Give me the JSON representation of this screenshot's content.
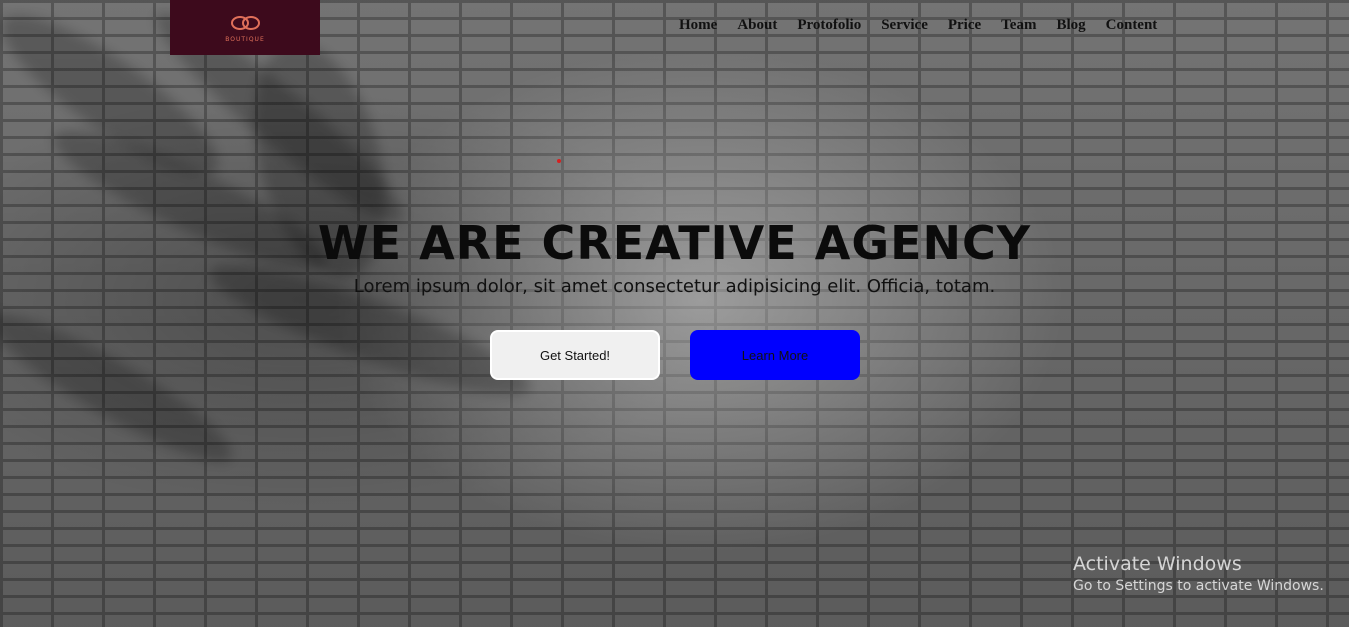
{
  "header": {
    "logo_text": "BOUTIQUE",
    "nav": [
      {
        "label": "Home"
      },
      {
        "label": "About"
      },
      {
        "label": "Protofolio"
      },
      {
        "label": "Service"
      },
      {
        "label": "Price"
      },
      {
        "label": "Team"
      },
      {
        "label": "Blog"
      },
      {
        "label": "Content"
      }
    ]
  },
  "hero": {
    "title": "WE ARE CREATIVE AGENCY",
    "subtitle": "Lorem ipsum dolor, sit amet consectetur adipisicing elit. Officia, totam.",
    "primary_button": "Get Started!",
    "secondary_button": "Learn More"
  },
  "watermark": {
    "title": "Activate Windows",
    "subtitle": "Go to Settings to activate Windows."
  },
  "colors": {
    "logo_bg": "#3d0a1c",
    "primary_button_bg": "#f0f0f0",
    "secondary_button_bg": "#0000ff"
  }
}
